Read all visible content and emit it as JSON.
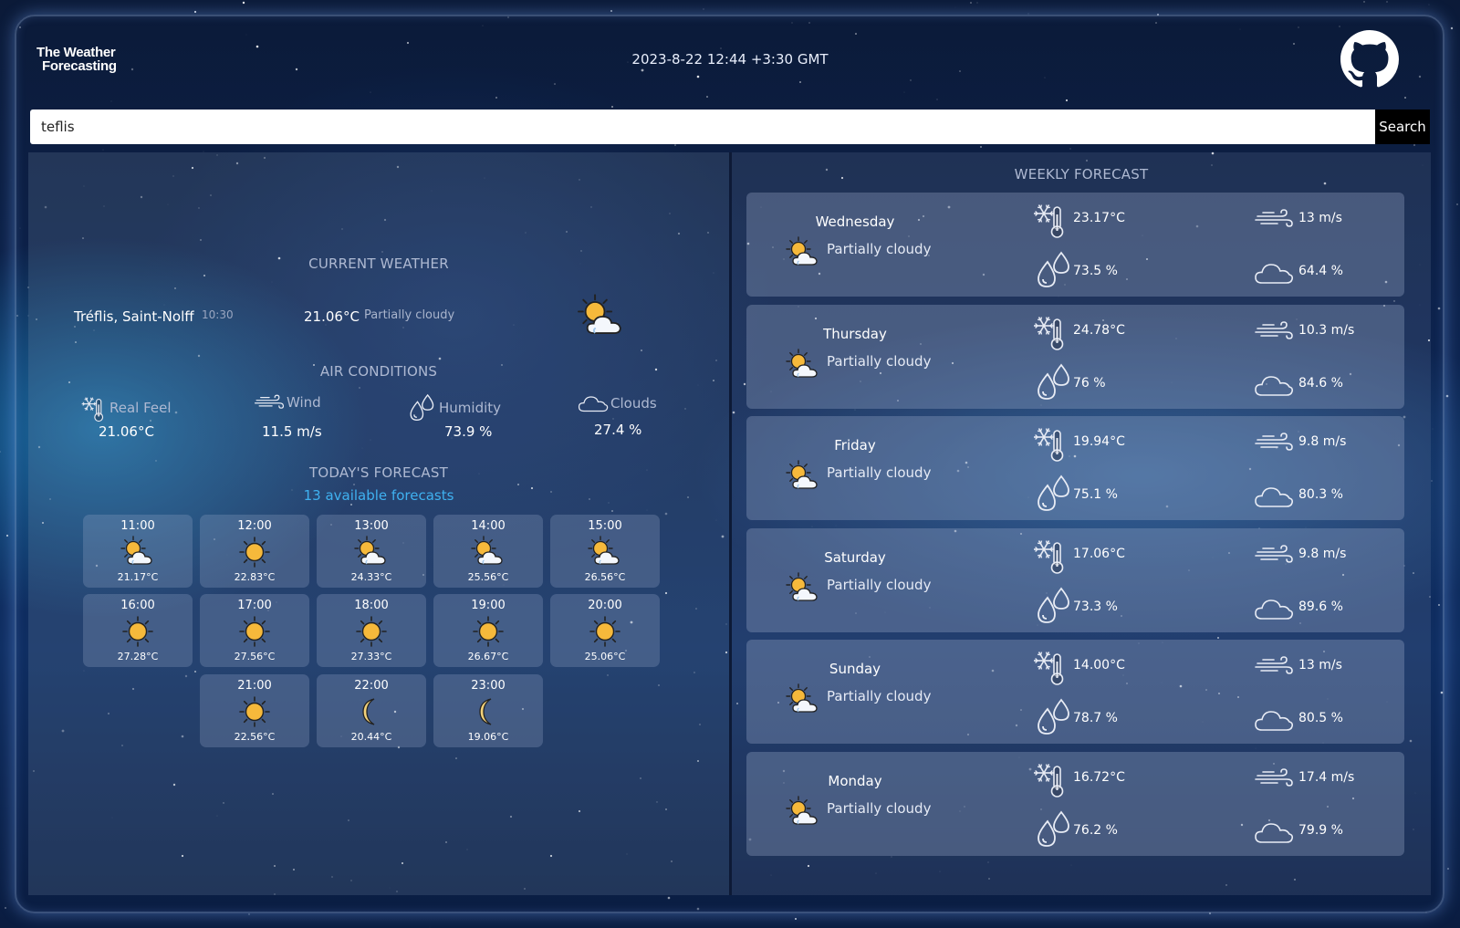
{
  "header": {
    "logo_line1": "The Weather",
    "logo_line2": "Forecasting",
    "datetime": "2023-8-22 12:44 +3:30 GMT"
  },
  "search": {
    "value": "teflis",
    "button_label": "Search"
  },
  "current": {
    "section_title": "CURRENT WEATHER",
    "city": "Tréflis, Saint-Nolff",
    "local_time": "10:30",
    "temperature": "21.06°C",
    "description": "Partially cloudy",
    "icon": "partly-cloudy-icon"
  },
  "air": {
    "section_title": "AIR CONDITIONS",
    "real_feel_label": "Real Feel",
    "real_feel_value": "21.06°C",
    "wind_label": "Wind",
    "wind_value": "11.5 m/s",
    "humidity_label": "Humidity",
    "humidity_value": "73.9 %",
    "clouds_label": "Clouds",
    "clouds_value": "27.4 %"
  },
  "today": {
    "section_title": "TODAY'S FORECAST",
    "available_link": "13 available forecasts",
    "hours": [
      {
        "time": "11:00",
        "temp": "21.17°C",
        "icon": "partly-cloudy"
      },
      {
        "time": "12:00",
        "temp": "22.83°C",
        "icon": "sun"
      },
      {
        "time": "13:00",
        "temp": "24.33°C",
        "icon": "partly-cloudy"
      },
      {
        "time": "14:00",
        "temp": "25.56°C",
        "icon": "partly-cloudy"
      },
      {
        "time": "15:00",
        "temp": "26.56°C",
        "icon": "partly-cloudy"
      },
      {
        "time": "16:00",
        "temp": "27.28°C",
        "icon": "sun"
      },
      {
        "time": "17:00",
        "temp": "27.56°C",
        "icon": "sun"
      },
      {
        "time": "18:00",
        "temp": "27.33°C",
        "icon": "sun"
      },
      {
        "time": "19:00",
        "temp": "26.67°C",
        "icon": "sun"
      },
      {
        "time": "20:00",
        "temp": "25.06°C",
        "icon": "sun"
      },
      {
        "time": "21:00",
        "temp": "22.56°C",
        "icon": "sun"
      },
      {
        "time": "22:00",
        "temp": "20.44°C",
        "icon": "moon"
      },
      {
        "time": "23:00",
        "temp": "19.06°C",
        "icon": "moon"
      }
    ]
  },
  "weekly": {
    "section_title": "WEEKLY FORECAST",
    "days": [
      {
        "day": "Wednesday",
        "desc": "Partially cloudy",
        "temp": "23.17°C",
        "humidity": "73.5 %",
        "wind": "13 m/s",
        "clouds": "64.4 %"
      },
      {
        "day": "Thursday",
        "desc": "Partially cloudy",
        "temp": "24.78°C",
        "humidity": "76 %",
        "wind": "10.3 m/s",
        "clouds": "84.6 %"
      },
      {
        "day": "Friday",
        "desc": "Partially cloudy",
        "temp": "19.94°C",
        "humidity": "75.1 %",
        "wind": "9.8 m/s",
        "clouds": "80.3 %"
      },
      {
        "day": "Saturday",
        "desc": "Partially cloudy",
        "temp": "17.06°C",
        "humidity": "73.3 %",
        "wind": "9.8 m/s",
        "clouds": "89.6 %"
      },
      {
        "day": "Sunday",
        "desc": "Partially cloudy",
        "temp": "14.00°C",
        "humidity": "78.7 %",
        "wind": "13 m/s",
        "clouds": "80.5 %"
      },
      {
        "day": "Monday",
        "desc": "Partially cloudy",
        "temp": "16.72°C",
        "humidity": "76.2 %",
        "wind": "17.4 m/s",
        "clouds": "79.9 %"
      }
    ]
  },
  "colors": {
    "link": "#3fb1f0",
    "sun": "#f6b93b",
    "moon": "#f3d27a"
  }
}
